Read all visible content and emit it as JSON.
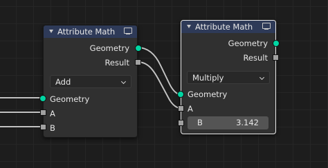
{
  "left_node": {
    "title": "Attribute Math",
    "outputs": {
      "geometry": "Geometry",
      "result": "Result"
    },
    "operation": "Add",
    "inputs": {
      "geometry": "Geometry",
      "a": "A",
      "b": "B"
    }
  },
  "right_node": {
    "title": "Attribute Math",
    "outputs": {
      "geometry": "Geometry",
      "result": "Result"
    },
    "operation": "Multiply",
    "inputs": {
      "geometry": "Geometry",
      "a": "A"
    },
    "b_field": {
      "label": "B",
      "value": "3.142"
    }
  },
  "colors": {
    "geometry_socket": "#00d6a3",
    "float_socket": "#a1a1a1",
    "header": "#2e3a58",
    "wire": "#c2c2c2"
  },
  "icons": [
    "collapse-arrow-icon",
    "monitor-icon",
    "chevron-down-icon"
  ]
}
